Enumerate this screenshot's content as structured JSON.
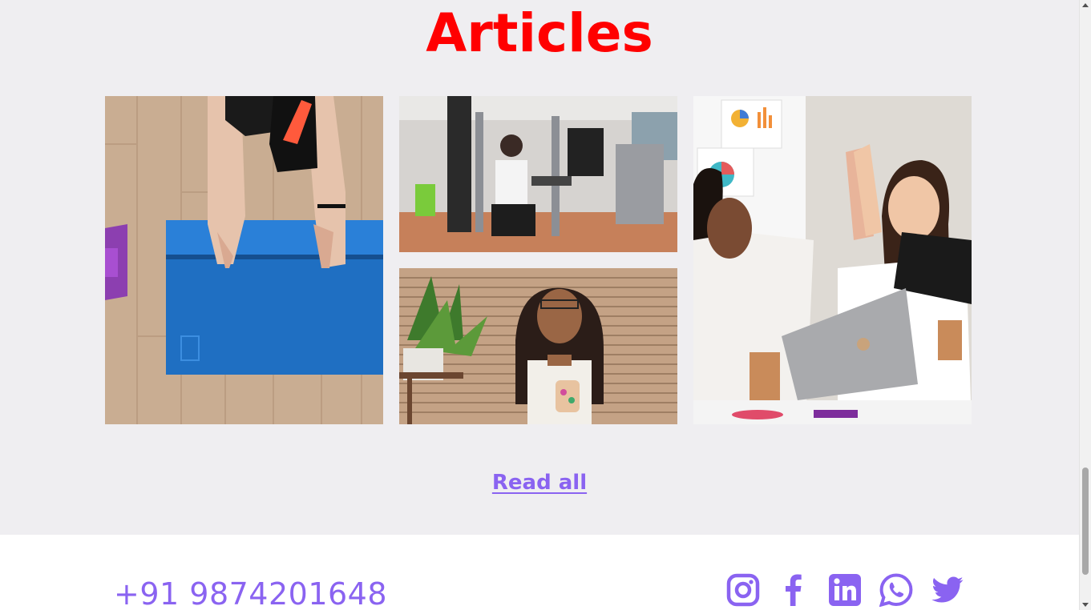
{
  "articles": {
    "title": "Articles",
    "cards": [
      {
        "image": "woman-rolling-blue-yoga-mat-photo"
      },
      {
        "image": "woman-using-gym-machine-photo"
      },
      {
        "image": "woman-holding-coffee-mug-photo"
      },
      {
        "image": "coworkers-high-five-office-photo"
      }
    ],
    "read_all_label": "Read all"
  },
  "footer": {
    "phone": "+91 9874201648",
    "social": [
      {
        "icon": "instagram-icon"
      },
      {
        "icon": "facebook-icon"
      },
      {
        "icon": "linkedin-icon"
      },
      {
        "icon": "whatsapp-icon"
      },
      {
        "icon": "twitter-icon"
      }
    ]
  },
  "colors": {
    "title": "#ff0000",
    "accent": "#8a63f1",
    "section_bg": "#efeef1",
    "footer_bg": "#ffffff"
  }
}
